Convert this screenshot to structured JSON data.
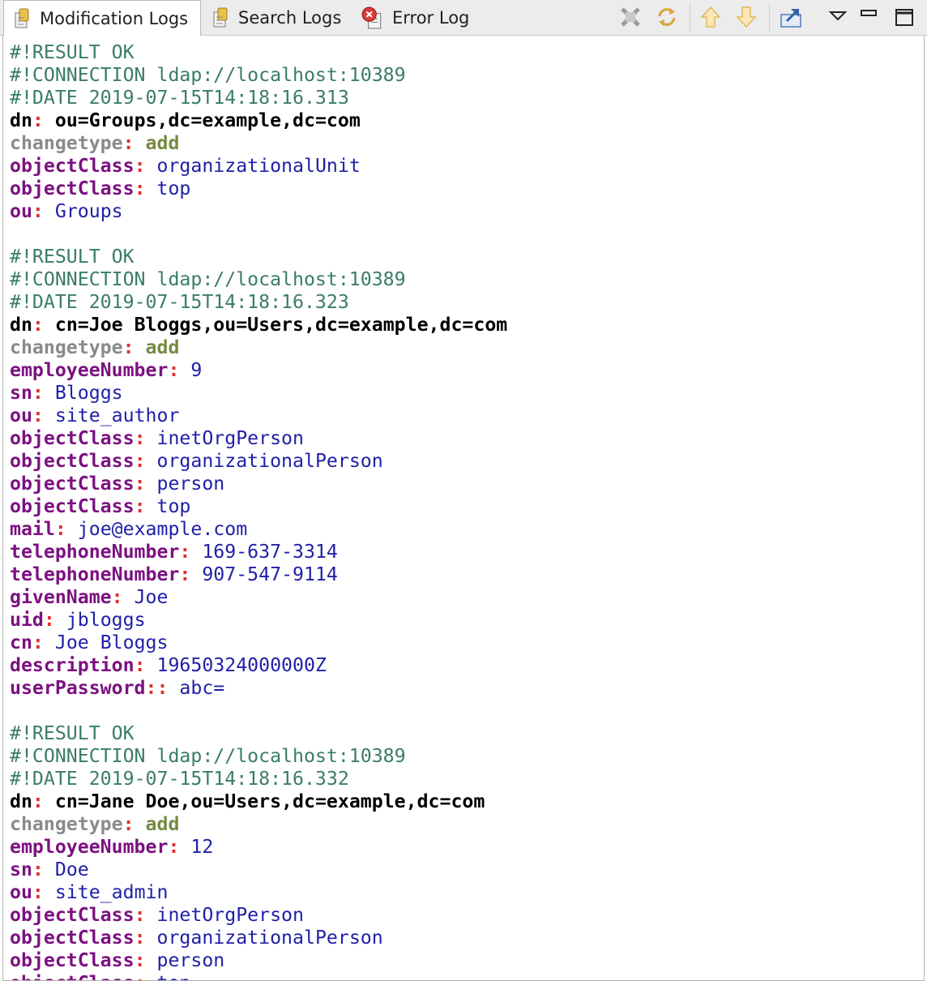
{
  "tabs": [
    {
      "label": "Modification Logs",
      "icon": "log-file-icon",
      "active": true
    },
    {
      "label": "Search Logs",
      "icon": "log-file-icon",
      "active": false
    },
    {
      "label": "Error Log",
      "icon": "error-log-icon",
      "active": false
    }
  ],
  "toolbar": {
    "icons": [
      "clear-icon",
      "refresh-icon",
      "move-up-icon",
      "move-down-icon",
      "export-icon",
      "view-menu-icon",
      "minimize-icon",
      "maximize-icon"
    ]
  },
  "colors": {
    "comment": "#3a7d63",
    "dn": "#000000",
    "changetype_key": "#8a8a8a",
    "changetype_value": "#778a43",
    "attribute_key": "#7c1181",
    "attribute_value": "#1f1fa8",
    "separator": "#e03030"
  },
  "log": [
    {
      "t": "c",
      "text": "#!RESULT OK"
    },
    {
      "t": "c",
      "text": "#!CONNECTION ldap://localhost:10389"
    },
    {
      "t": "c",
      "text": "#!DATE 2019-07-15T14:18:16.313"
    },
    {
      "t": "dn",
      "k": "dn",
      "s": ":",
      "v": "ou=Groups,dc=example,dc=com"
    },
    {
      "t": "ct",
      "k": "changetype",
      "s": ":",
      "v": "add"
    },
    {
      "t": "a",
      "k": "objectClass",
      "s": ":",
      "v": "organizationalUnit"
    },
    {
      "t": "a",
      "k": "objectClass",
      "s": ":",
      "v": "top"
    },
    {
      "t": "a",
      "k": "ou",
      "s": ":",
      "v": "Groups"
    },
    {
      "t": "blank"
    },
    {
      "t": "c",
      "text": "#!RESULT OK"
    },
    {
      "t": "c",
      "text": "#!CONNECTION ldap://localhost:10389"
    },
    {
      "t": "c",
      "text": "#!DATE 2019-07-15T14:18:16.323"
    },
    {
      "t": "dn",
      "k": "dn",
      "s": ":",
      "v": "cn=Joe Bloggs,ou=Users,dc=example,dc=com"
    },
    {
      "t": "ct",
      "k": "changetype",
      "s": ":",
      "v": "add"
    },
    {
      "t": "a",
      "k": "employeeNumber",
      "s": ":",
      "v": "9"
    },
    {
      "t": "a",
      "k": "sn",
      "s": ":",
      "v": "Bloggs"
    },
    {
      "t": "a",
      "k": "ou",
      "s": ":",
      "v": "site_author"
    },
    {
      "t": "a",
      "k": "objectClass",
      "s": ":",
      "v": "inetOrgPerson"
    },
    {
      "t": "a",
      "k": "objectClass",
      "s": ":",
      "v": "organizationalPerson"
    },
    {
      "t": "a",
      "k": "objectClass",
      "s": ":",
      "v": "person"
    },
    {
      "t": "a",
      "k": "objectClass",
      "s": ":",
      "v": "top"
    },
    {
      "t": "a",
      "k": "mail",
      "s": ":",
      "v": "joe@example.com"
    },
    {
      "t": "a",
      "k": "telephoneNumber",
      "s": ":",
      "v": "169-637-3314"
    },
    {
      "t": "a",
      "k": "telephoneNumber",
      "s": ":",
      "v": "907-547-9114"
    },
    {
      "t": "a",
      "k": "givenName",
      "s": ":",
      "v": "Joe"
    },
    {
      "t": "a",
      "k": "uid",
      "s": ":",
      "v": "jbloggs"
    },
    {
      "t": "a",
      "k": "cn",
      "s": ":",
      "v": "Joe Bloggs"
    },
    {
      "t": "a",
      "k": "description",
      "s": ":",
      "v": "19650324000000Z"
    },
    {
      "t": "a",
      "k": "userPassword",
      "s": "::",
      "v": "abc="
    },
    {
      "t": "blank"
    },
    {
      "t": "c",
      "text": "#!RESULT OK"
    },
    {
      "t": "c",
      "text": "#!CONNECTION ldap://localhost:10389"
    },
    {
      "t": "c",
      "text": "#!DATE 2019-07-15T14:18:16.332"
    },
    {
      "t": "dn",
      "k": "dn",
      "s": ":",
      "v": "cn=Jane Doe,ou=Users,dc=example,dc=com"
    },
    {
      "t": "ct",
      "k": "changetype",
      "s": ":",
      "v": "add"
    },
    {
      "t": "a",
      "k": "employeeNumber",
      "s": ":",
      "v": "12"
    },
    {
      "t": "a",
      "k": "sn",
      "s": ":",
      "v": "Doe"
    },
    {
      "t": "a",
      "k": "ou",
      "s": ":",
      "v": "site_admin"
    },
    {
      "t": "a",
      "k": "objectClass",
      "s": ":",
      "v": "inetOrgPerson"
    },
    {
      "t": "a",
      "k": "objectClass",
      "s": ":",
      "v": "organizationalPerson"
    },
    {
      "t": "a",
      "k": "objectClass",
      "s": ":",
      "v": "person"
    },
    {
      "t": "a",
      "k": "objectClass",
      "s": ":",
      "v": "top"
    }
  ]
}
